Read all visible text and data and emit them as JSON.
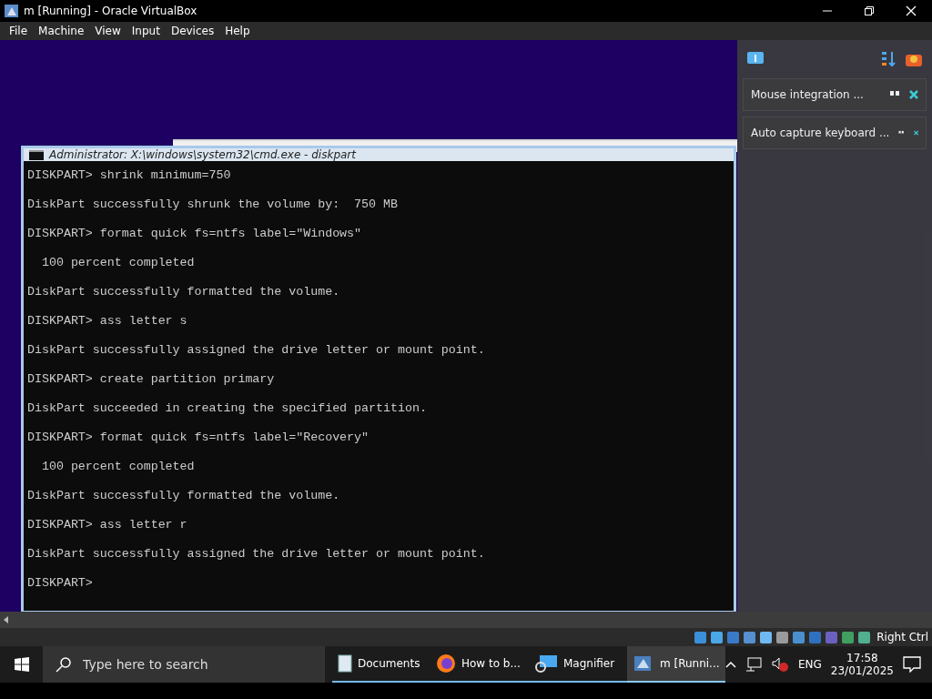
{
  "window": {
    "title": "m [Running] - Oracle VirtualBox"
  },
  "menu": [
    "File",
    "Machine",
    "View",
    "Input",
    "Devices",
    "Help"
  ],
  "console": {
    "title": "Administrator: X:\\windows\\system32\\cmd.exe - diskpart",
    "lines": [
      "DISKPART> shrink minimum=750",
      "DiskPart successfully shrunk the volume by:  750 MB",
      "DISKPART> format quick fs=ntfs label=\"Windows\"",
      "  100 percent completed",
      "DiskPart successfully formatted the volume.",
      "DISKPART> ass letter s",
      "DiskPart successfully assigned the drive letter or mount point.",
      "DISKPART> create partition primary",
      "DiskPart succeeded in creating the specified partition.",
      "DISKPART> format quick fs=ntfs label=\"Recovery\"",
      "  100 percent completed",
      "DiskPart successfully formatted the volume.",
      "DISKPART> ass letter r",
      "DiskPart successfully assigned the drive letter or mount point.",
      "DISKPART>"
    ]
  },
  "notifications": [
    "Mouse integration ...",
    "Auto capture keyboard ..."
  ],
  "status_bar": {
    "host_key": "Right Ctrl"
  },
  "taskbar": {
    "search_placeholder": "Type here to search",
    "apps": [
      {
        "label": "Documents",
        "kind": "folder",
        "selected": false
      },
      {
        "label": "How to b...",
        "kind": "browser",
        "selected": false
      },
      {
        "label": "Magnifier",
        "kind": "magnifier",
        "selected": false
      },
      {
        "label": "m [Runni...",
        "kind": "vbox",
        "selected": true
      }
    ],
    "language": "ENG",
    "time": "17:58",
    "date": "23/01/2025"
  }
}
